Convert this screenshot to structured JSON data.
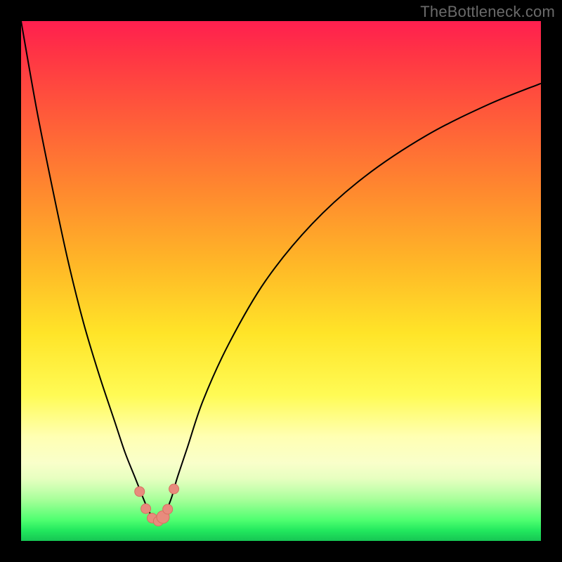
{
  "watermark": "TheBottleneck.com",
  "colors": {
    "frame": "#000000",
    "curve": "#000000",
    "marker_fill": "#e88b7d",
    "marker_stroke": "#d86f5f"
  },
  "chart_data": {
    "type": "line",
    "title": "",
    "xlabel": "",
    "ylabel": "",
    "xlim": [
      0,
      100
    ],
    "ylim": [
      0,
      100
    ],
    "grid": false,
    "legend": false,
    "note": "Values are percentages of plot width (x) and height from top (y). Lower y = closer to top (worse/red). Curve dips to ~96 (green) near x≈26.",
    "series": [
      {
        "name": "bottleneck-curve",
        "x": [
          0,
          3,
          6,
          9,
          12,
          15,
          18,
          20,
          22,
          24,
          25,
          26,
          27,
          28,
          29,
          30,
          32,
          35,
          40,
          47,
          56,
          66,
          78,
          90,
          100
        ],
        "y": [
          0,
          17,
          32,
          46,
          58,
          68,
          77,
          83,
          88,
          93,
          95,
          96,
          95.5,
          94,
          91.5,
          88,
          82,
          73,
          62,
          50,
          39,
          30,
          22,
          16,
          12
        ]
      }
    ],
    "markers": {
      "name": "near-minimum-points",
      "x": [
        22.8,
        24.0,
        25.2,
        26.4,
        27.3,
        28.2,
        29.4
      ],
      "y": [
        90.5,
        93.8,
        95.6,
        96.2,
        95.4,
        93.9,
        90.0
      ],
      "r": [
        7,
        7,
        7,
        7,
        9,
        7,
        7
      ]
    }
  }
}
